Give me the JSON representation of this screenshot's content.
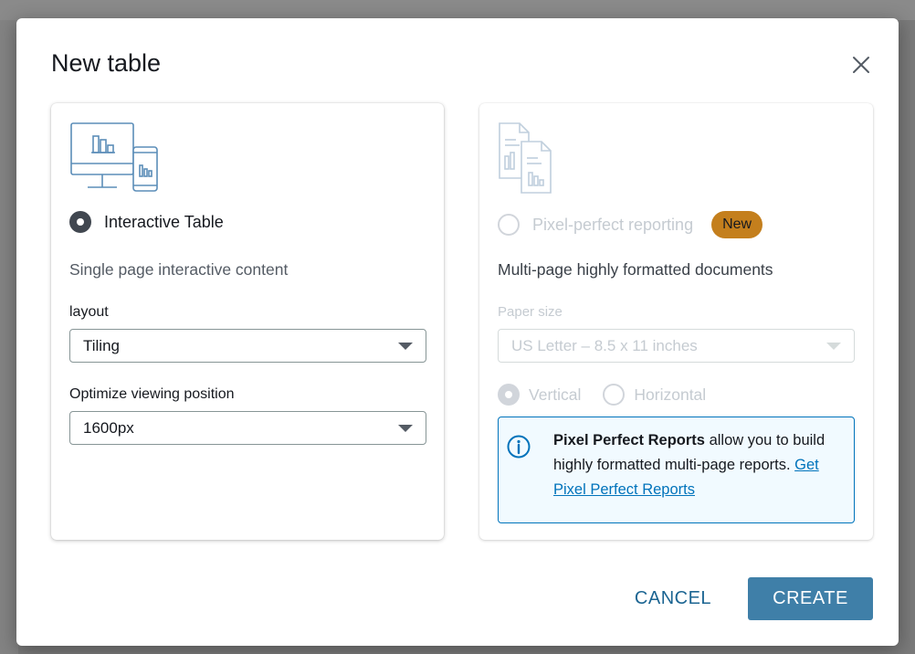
{
  "dialog": {
    "title": "New table",
    "close_icon": "close-icon"
  },
  "interactive": {
    "icon": "desktop-mobile-chart-icon",
    "label": "Interactive Table",
    "selected": true,
    "description": "Single page interactive content",
    "layout_label": "layout",
    "layout_value": "Tiling",
    "viewing_label": "Optimize viewing position",
    "viewing_value": "1600px"
  },
  "pixel": {
    "icon": "documents-chart-icon",
    "label": "Pixel-perfect reporting",
    "badge": "New",
    "selected": false,
    "description": "Multi-page highly formatted documents",
    "paper_label": "Paper size",
    "paper_value": "US Letter – 8.5 x 11 inches",
    "orientation": {
      "vertical": "Vertical",
      "horizontal": "Horizontal",
      "selected": "Vertical"
    },
    "info": {
      "icon": "info-icon",
      "bold": "Pixel Perfect Reports",
      "text": " allow you to build highly formatted multi-page reports. ",
      "link": "Get Pixel Perfect Reports"
    }
  },
  "footer": {
    "cancel": "CANCEL",
    "create": "CREATE"
  },
  "colors": {
    "primary": "#3f7fa8",
    "link": "#0073bb",
    "badge": "#c47f1d",
    "info_bg": "#f1faff"
  }
}
